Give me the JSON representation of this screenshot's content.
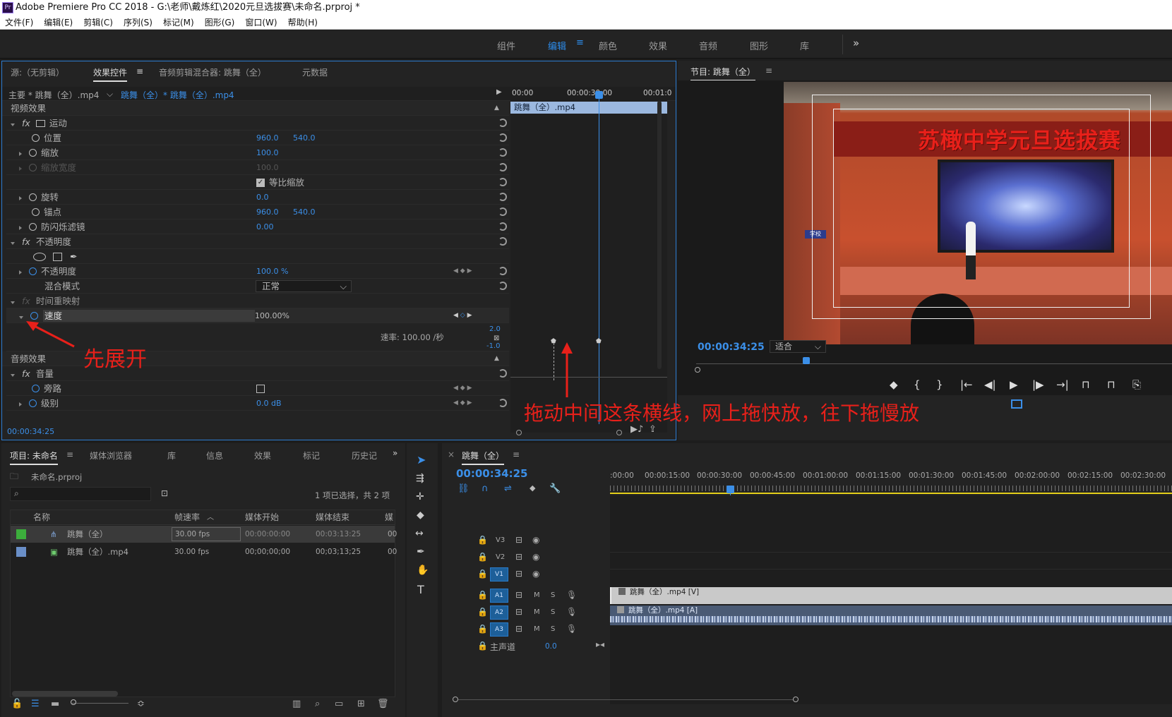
{
  "window": {
    "title": "Adobe Premiere Pro CC 2018 - G:\\老师\\戴炼红\\2020元旦选拔赛\\未命名.prproj *",
    "logo": "Pr"
  },
  "menu": [
    "文件(F)",
    "编辑(E)",
    "剪辑(C)",
    "序列(S)",
    "标记(M)",
    "图形(G)",
    "窗口(W)",
    "帮助(H)"
  ],
  "workspaces": [
    "组件",
    "编辑",
    "颜色",
    "效果",
    "音频",
    "图形",
    "库"
  ],
  "workspace_active": "编辑",
  "workspace_more": "»",
  "effects_panel": {
    "tabs": [
      "源:（无剪辑）",
      "效果控件",
      "音频剪辑混合器: 跳舞（全）",
      "元数据"
    ],
    "active_tab": "效果控件",
    "master_label": "主要 * 跳舞（全）.mp4",
    "sequence_clip": "跳舞（全）* 跳舞（全）.mp4",
    "mini_clip": "跳舞（全）.mp4",
    "mini_ruler": [
      "00:00",
      "00:00:30:00",
      "00:01:0"
    ],
    "video_effects": "视频效果",
    "motion": "运动",
    "position": {
      "label": "位置",
      "x": "960.0",
      "y": "540.0"
    },
    "scale": {
      "label": "缩放",
      "value": "100.0"
    },
    "scale_width": {
      "label": "缩放宽度",
      "value": "100.0"
    },
    "uniform": {
      "label": "等比缩放"
    },
    "rotation": {
      "label": "旋转",
      "value": "0.0"
    },
    "anchor": {
      "label": "锚点",
      "x": "960.0",
      "y": "540.0"
    },
    "flicker": {
      "label": "防闪烁滤镜",
      "value": "0.00"
    },
    "opacity_group": "不透明度",
    "opacity": {
      "label": "不透明度",
      "value": "100.0 %"
    },
    "blend": {
      "label": "混合模式",
      "value": "正常"
    },
    "time_remap": "时间重映射",
    "speed": {
      "label": "速度",
      "value": "100.00%"
    },
    "rate": "速率: 100.00 /秒",
    "graph_top": "2.0",
    "graph_bottom": "-1.0",
    "audio_effects": "音频效果",
    "volume": "音量",
    "bypass": "旁路",
    "level": {
      "label": "级别",
      "value": "0.0 dB"
    },
    "timecode": "00:00:34:25"
  },
  "annotations": {
    "expand": "先展开",
    "drag": "拖动中间这条横线，网上拖快放，往下拖慢放"
  },
  "program": {
    "title": "节目: 跳舞（全）",
    "timecode": "00:00:34:25",
    "fit": "适合",
    "stage_banner": "苏橄中学元旦选拔赛",
    "sign": "学校"
  },
  "project": {
    "tabs": [
      "项目: 未命名",
      "媒体浏览器",
      "库",
      "信息",
      "效果",
      "标记",
      "历史记"
    ],
    "file": "未命名.prproj",
    "selection": "1 项已选择，共 2 项",
    "columns": [
      "名称",
      "帧速率",
      "媒体开始",
      "媒体结束",
      "媒"
    ],
    "rows": [
      {
        "name": "跳舞（全）",
        "fps": "30.00 fps",
        "start": "00:00:00:00",
        "end": "00:03:13:25",
        "more": "00",
        "color": "#3cae3c"
      },
      {
        "name": "跳舞（全）.mp4",
        "fps": "30.00 fps",
        "start": "00;00;00;00",
        "end": "00;03;13;25",
        "more": "00",
        "color": "#6a8fc8"
      }
    ]
  },
  "timeline": {
    "title": "跳舞（全）",
    "timecode": "00:00:34:25",
    "ruler": [
      ":00:00",
      "00:00:15:00",
      "00:00:30:00",
      "00:00:45:00",
      "00:01:00:00",
      "00:01:15:00",
      "00:01:30:00",
      "00:01:45:00",
      "00:02:00:00",
      "00:02:15:00",
      "00:02:30:00"
    ],
    "tracks": [
      "V3",
      "V2",
      "V1",
      "A1",
      "A2",
      "A3"
    ],
    "video_clip": "跳舞（全）.mp4 [V]",
    "audio_clip": "跳舞（全）.mp4 [A]",
    "master": "主声道",
    "master_value": "0.0",
    "mute": "M",
    "solo": "S"
  }
}
